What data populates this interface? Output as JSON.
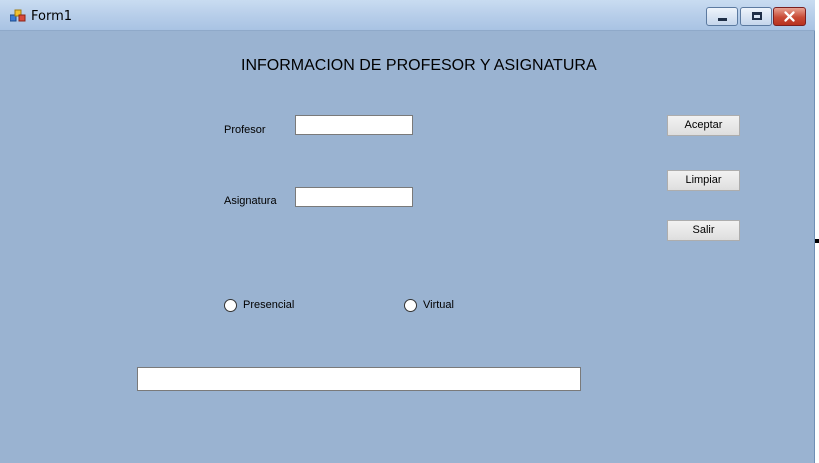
{
  "window": {
    "title": "Form1"
  },
  "form": {
    "heading": "INFORMACION DE PROFESOR Y ASIGNATURA",
    "profesor_label": "Profesor",
    "profesor_value": "",
    "asignatura_label": "Asignatura",
    "asignatura_value": "",
    "radio_presencial": "Presencial",
    "radio_virtual": "Virtual",
    "result_value": ""
  },
  "buttons": {
    "aceptar": "Aceptar",
    "limpiar": "Limpiar",
    "salir": "Salir"
  },
  "colors": {
    "form_background": "#9ab3d1"
  },
  "icons": {
    "app": "form-app-icon",
    "minimize": "minimize-icon",
    "maximize": "maximize-icon",
    "close": "close-icon"
  }
}
